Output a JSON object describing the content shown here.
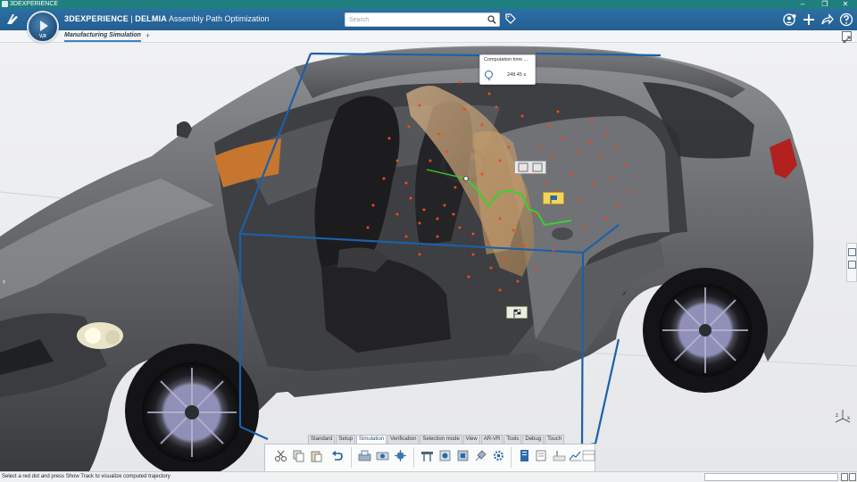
{
  "os_window": {
    "title": "3DEXPERIENCE",
    "minimize": "–",
    "restore": "❐",
    "close": "✕"
  },
  "header": {
    "brand_prefix": "3DEXPERIENCE",
    "brand_separator": " | ",
    "brand_product": "DELMIA",
    "app_name": "Assembly Path Optimization",
    "search_placeholder": "Search",
    "compass_label": "V,R"
  },
  "tabs": {
    "active": "Manufacturing Simulation",
    "add": "+"
  },
  "viewport": {
    "computation_title": "Computation time ...",
    "computation_value": "248.45 s",
    "axis_x": "x",
    "axis_z": "z"
  },
  "action_bar": {
    "tabs": [
      "Standard",
      "Setup",
      "Simulation",
      "Verification",
      "Selection mode",
      "View",
      "AR-VR",
      "Tools",
      "Debug",
      "Touch"
    ],
    "active_tab": "Simulation"
  },
  "status": {
    "message": "Select a red dot and press Show Track to visualize computed trajectory"
  },
  "colors": {
    "accent": "#2d6fa3",
    "os_bar": "#1f7f7f",
    "trajectory": "#3ccf2e",
    "samples": "#f04a1a",
    "bounding_box": "#1d5fa8"
  }
}
